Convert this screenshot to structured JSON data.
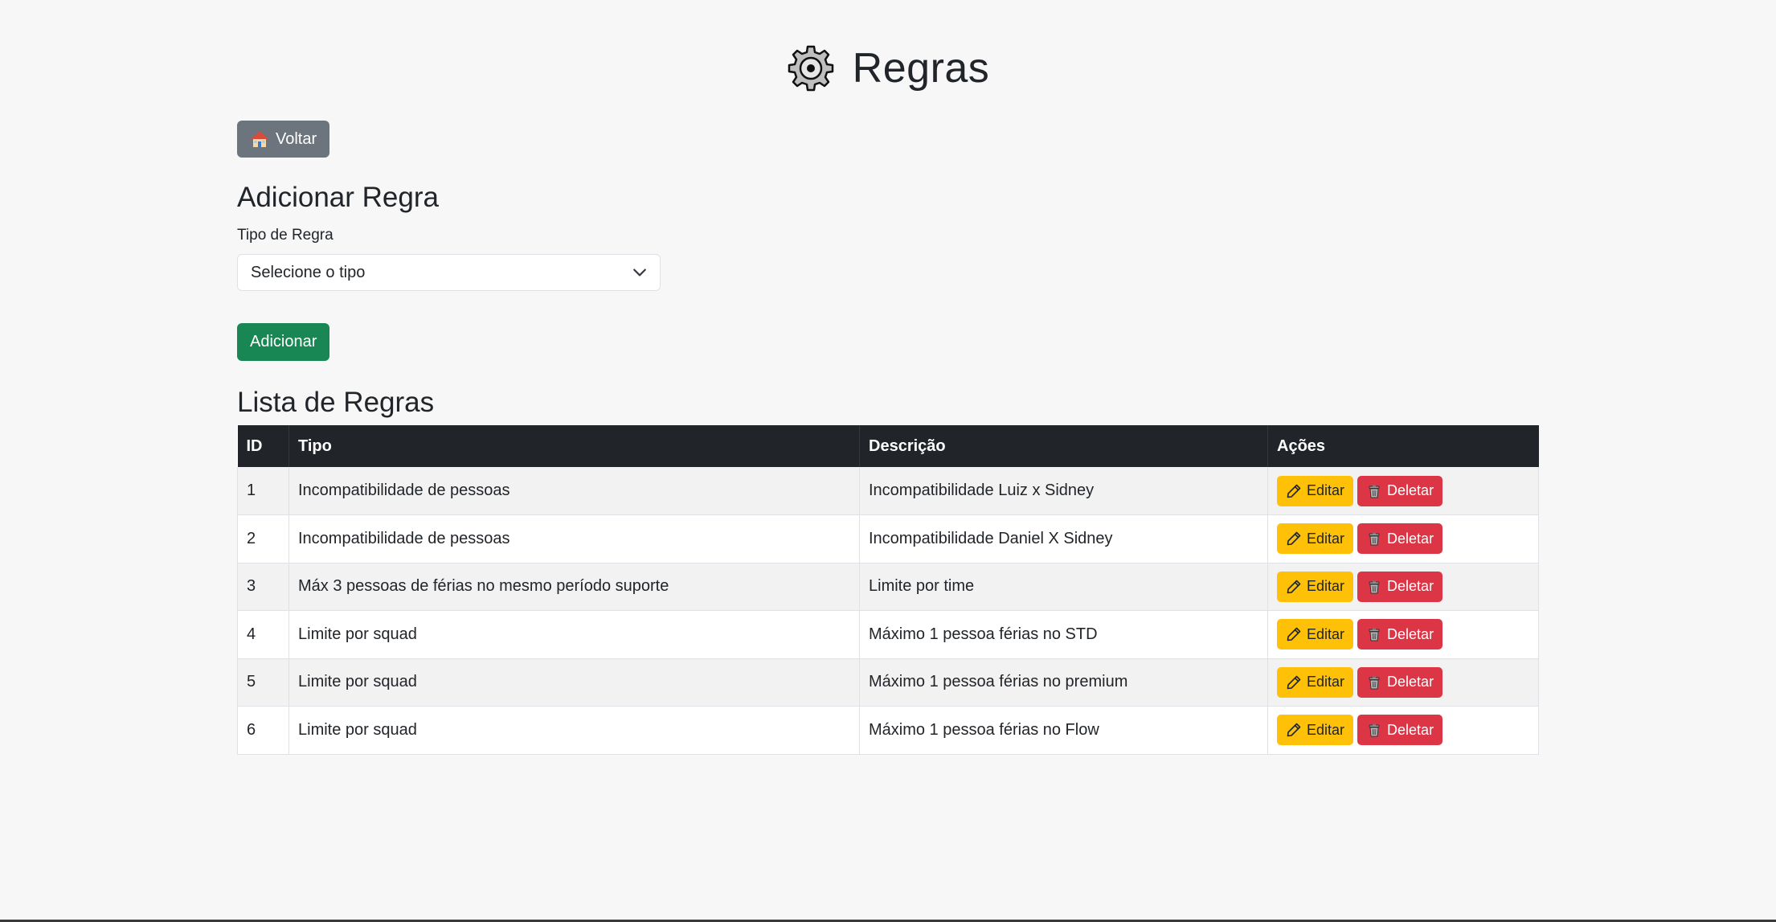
{
  "page": {
    "title": "Regras"
  },
  "back_button": {
    "label": "Voltar"
  },
  "add_section": {
    "title": "Adicionar Regra",
    "type_label": "Tipo de Regra",
    "select_value": "Selecione o tipo",
    "add_button": "Adicionar"
  },
  "list_section": {
    "title": "Lista de Regras",
    "columns": [
      "ID",
      "Tipo",
      "Descrição",
      "Ações"
    ],
    "edit_label": "Editar",
    "delete_label": "Deletar",
    "rows": [
      {
        "id": "1",
        "tipo": "Incompatibilidade de pessoas",
        "descricao": "Incompatibilidade Luiz x Sidney"
      },
      {
        "id": "2",
        "tipo": "Incompatibilidade de pessoas",
        "descricao": "Incompatibilidade Daniel X Sidney"
      },
      {
        "id": "3",
        "tipo": "Máx 3 pessoas de férias no mesmo período suporte",
        "descricao": "Limite por time"
      },
      {
        "id": "4",
        "tipo": "Limite por squad",
        "descricao": "Máximo 1 pessoa férias no STD"
      },
      {
        "id": "5",
        "tipo": "Limite por squad",
        "descricao": "Máximo 1 pessoa férias no premium"
      },
      {
        "id": "6",
        "tipo": "Limite por squad",
        "descricao": "Máximo 1 pessoa férias no Flow"
      }
    ]
  },
  "colors": {
    "background": "#f7f7f8",
    "back_button": "#6c757d",
    "add_button": "#198754",
    "table_header": "#212529",
    "edit_button": "#ffc107",
    "delete_button": "#dc3545"
  },
  "icons": {
    "title": "gear-icon",
    "back": "house-icon",
    "select": "chevron-down-icon",
    "edit": "pencil-icon",
    "delete": "trash-icon"
  }
}
